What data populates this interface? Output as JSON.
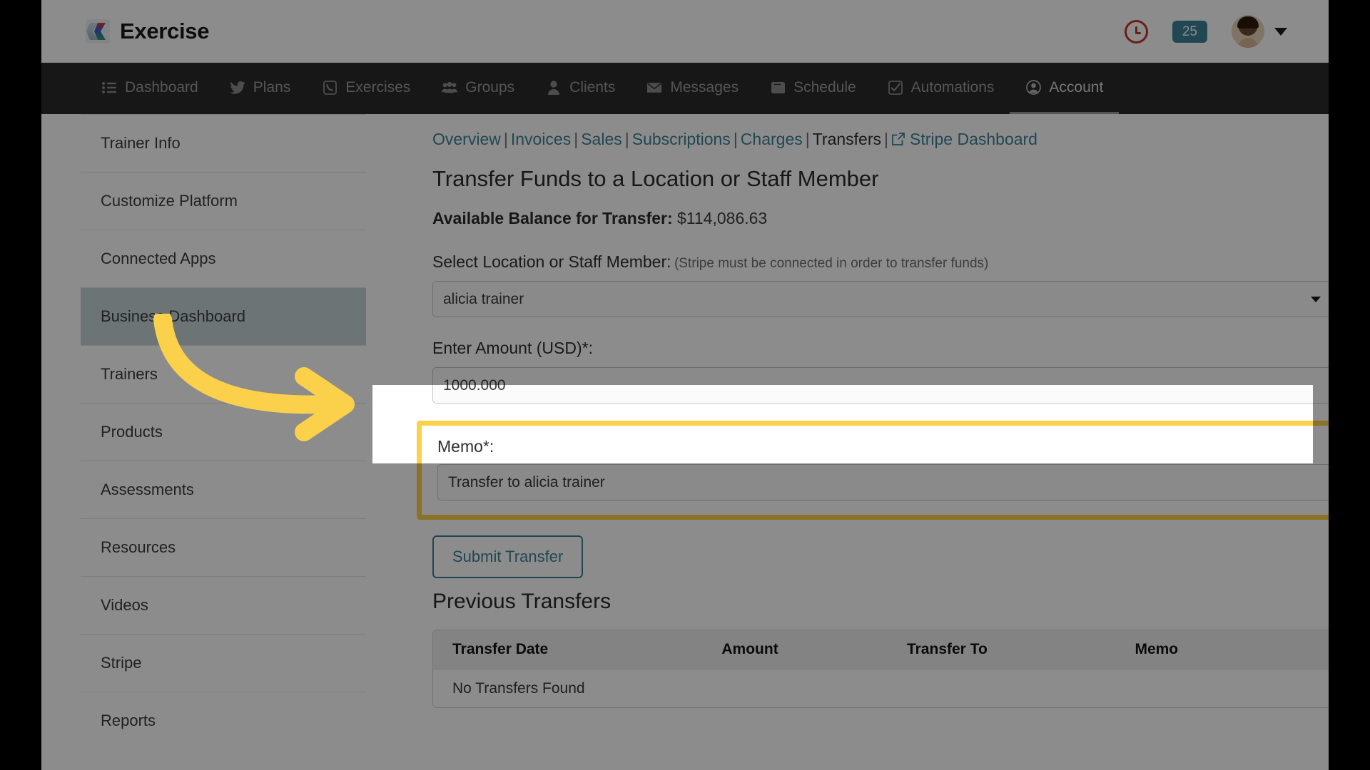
{
  "brand": {
    "name": "Exercise",
    "logo_icon": "chevron-logo-icon"
  },
  "topbar": {
    "clock_icon": "clock-icon",
    "message_badge": "25",
    "badge_color": "#3d8196",
    "avatar_icon": "avatar",
    "chevron_icon": "chevron-down-icon"
  },
  "nav": {
    "items": [
      {
        "label": "Dashboard",
        "icon": "list-icon",
        "active": false
      },
      {
        "label": "Plans",
        "icon": "twitter-bird-icon",
        "active": false
      },
      {
        "label": "Exercises",
        "icon": "phone-icon",
        "active": false
      },
      {
        "label": "Groups",
        "icon": "users-icon",
        "active": false
      },
      {
        "label": "Clients",
        "icon": "user-icon",
        "active": false
      },
      {
        "label": "Messages",
        "icon": "envelope-icon",
        "active": false
      },
      {
        "label": "Schedule",
        "icon": "book-icon",
        "active": false
      },
      {
        "label": "Automations",
        "icon": "check-square-icon",
        "active": false
      },
      {
        "label": "Account",
        "icon": "user-circle-icon",
        "active": true
      }
    ]
  },
  "sidebar": {
    "items": [
      {
        "label": "Trainer Info",
        "active": false
      },
      {
        "label": "Customize Platform",
        "active": false
      },
      {
        "label": "Connected Apps",
        "active": false
      },
      {
        "label": "Business Dashboard",
        "active": true
      },
      {
        "label": "Trainers",
        "active": false
      },
      {
        "label": "Products",
        "active": false
      },
      {
        "label": "Assessments",
        "active": false
      },
      {
        "label": "Resources",
        "active": false
      },
      {
        "label": "Videos",
        "active": false
      },
      {
        "label": "Stripe",
        "active": false
      },
      {
        "label": "Reports",
        "active": false
      }
    ]
  },
  "subnav": {
    "links": [
      "Overview",
      "Invoices",
      "Sales",
      "Subscriptions",
      "Charges"
    ],
    "current": "Transfers",
    "external": {
      "label": "Stripe Dashboard",
      "icon": "external-link-icon"
    },
    "separator": "|",
    "link_color": "#3d8196"
  },
  "main": {
    "page_title": "Transfer Funds to a Location or Staff Member",
    "balance_label": "Available Balance for Transfer:",
    "balance_value": "$114,086.63",
    "select_label": "Select Location or Staff Member:",
    "select_hint": "(Stripe must be connected in order to transfer funds)",
    "select_value": "alicia trainer",
    "select_caret_icon": "caret-down-icon",
    "amount_label": "Enter Amount (USD)*:",
    "amount_value": "1000.000",
    "memo_label": "Memo*:",
    "memo_value": "Transfer to alicia trainer",
    "submit_label": "Submit Transfer",
    "previous_title": "Previous Transfers",
    "highlight_color": "#fbd14b"
  },
  "table": {
    "headers": [
      "Transfer Date",
      "Amount",
      "Transfer To",
      "Memo"
    ],
    "empty_message": "No Transfers Found"
  },
  "annotation": {
    "arrow_icon": "curved-arrow-right-icon",
    "arrow_color": "#fbd14b"
  }
}
